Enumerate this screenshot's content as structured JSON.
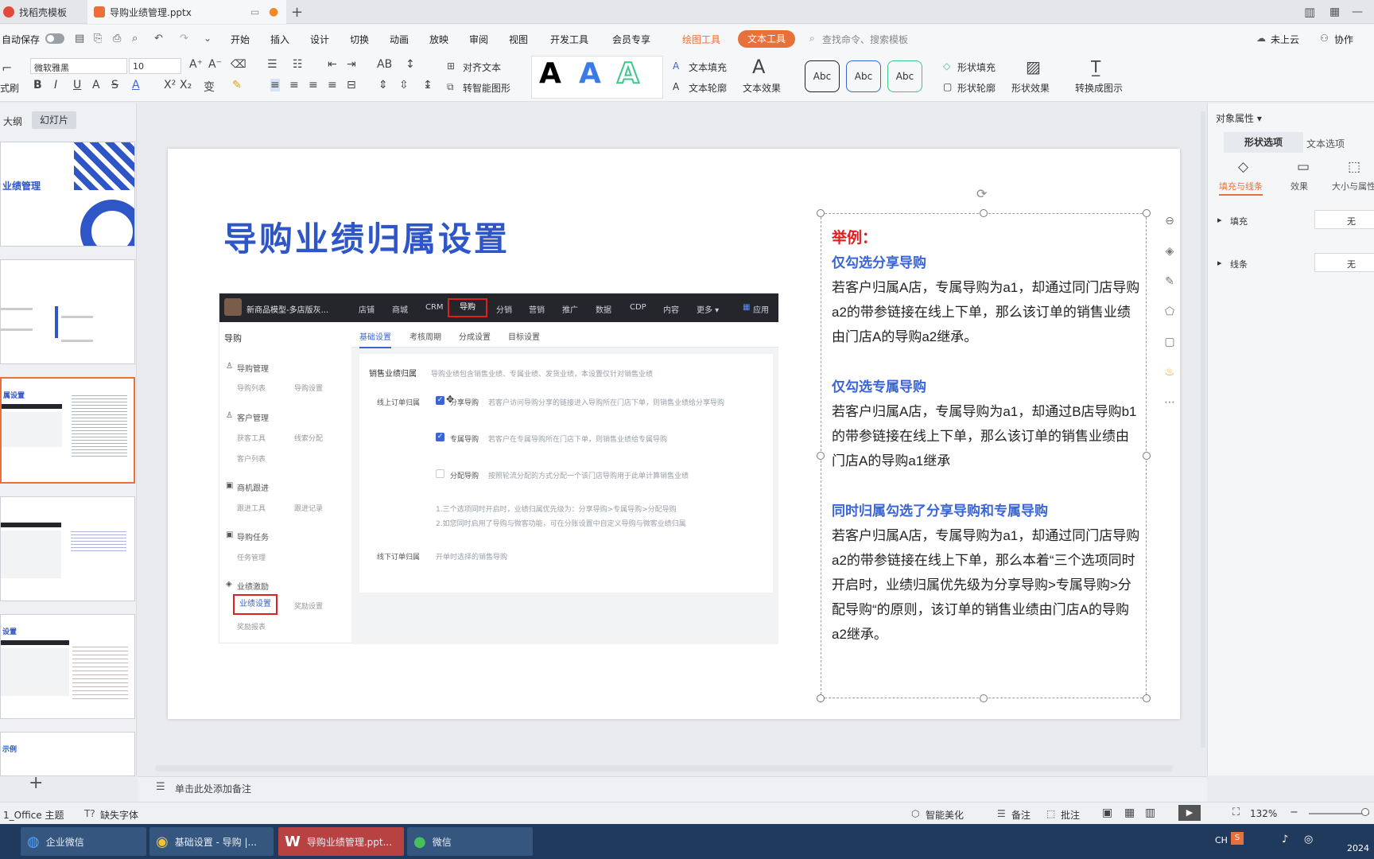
{
  "tabs": [
    {
      "label": "找稻壳模板"
    },
    {
      "label": "导购业绩管理.pptx"
    }
  ],
  "menu": {
    "autosave": "自动保存",
    "items": [
      "开始",
      "插入",
      "设计",
      "切换",
      "动画",
      "放映",
      "审阅",
      "视图",
      "开发工具",
      "会员专享"
    ],
    "drawing_tools": "绘图工具",
    "text_tools": "文本工具",
    "search_placeholder": "查找命令、搜索模板",
    "cloud": "未上云",
    "collab": "协作"
  },
  "ribbon": {
    "font": "微软雅黑",
    "size": "10",
    "align_text": "对齐文本",
    "smart_shape": "转智能图形",
    "text_fill": "文本填充",
    "text_outline": "文本轮廓",
    "text_effect": "文本效果",
    "abc": "Abc",
    "shape_fill": "形状填充",
    "shape_outline": "形状轮廓",
    "shape_effect": "形状效果",
    "convert": "转换成图示",
    "format": "式刷",
    "brand_colors": {
      "accent": "#e8703a",
      "blue": "#3b65d6",
      "red": "#e02020"
    }
  },
  "left": {
    "outline": "大纲",
    "slides": "幻灯片",
    "thumb1_title": "业绩管理",
    "thumb3_title": "属设置",
    "thumb5_title": "设置",
    "thumb6_title": "示例"
  },
  "slide": {
    "title": "导购业绩归属设置",
    "example_label": "举例：",
    "sections": [
      {
        "heading": "仅勾选分享导购",
        "body": "若客户归属A店，专属导购为a1，却通过同门店导购a2的带参链接在线上下单，那么该订单的销售业绩由门店A的导购a2继承。"
      },
      {
        "heading": "仅勾选专属导购",
        "body": "若客户归属A店，专属导购为a1，却通过B店导购b1的带参链接在线上下单，那么该订单的销售业绩由门店A的导购a1继承"
      },
      {
        "heading": "同时归属勾选了分享导购和专属导购",
        "body": "若客户归属A店，专属导购为a1，却通过同门店导购a2的带参链接在线上下单，那么本着“三个选项同时开启时，业绩归属优先级为分享导购>专属导购>分配导购“的原则，该订单的销售业绩由门店A的导购a2继承。"
      }
    ],
    "shot": {
      "store": "新商品模型-多店版灰...",
      "nav": [
        "店铺",
        "商城",
        "CRM",
        "导购",
        "分销",
        "营销",
        "推广",
        "数据",
        "CDP",
        "内容",
        "更多 ▾"
      ],
      "app": "应用",
      "side_title": "导购",
      "groups": [
        {
          "label": "导购管理",
          "subs": [
            "导购列表",
            "导购设置"
          ]
        },
        {
          "label": "客户管理",
          "subs": [
            "获客工具",
            "线索分配",
            "客户列表"
          ]
        },
        {
          "label": "商机跟进",
          "subs": [
            "跟进工具",
            "跟进记录"
          ]
        },
        {
          "label": "导购任务",
          "subs": [
            "任务管理"
          ]
        },
        {
          "label": "业绩激励",
          "subs": [
            "业绩设置",
            "奖励设置",
            "奖励报表"
          ]
        }
      ],
      "tabs": [
        "基础设置",
        "考核周期",
        "分成设置",
        "目标设置"
      ],
      "section_label": "销售业绩归属",
      "section_desc": "导购业绩包含销售业绩、专属业绩、发货业绩，本设置仅针对销售业绩",
      "online_label": "线上订单归属",
      "options": [
        {
          "name": "分享导购",
          "desc": "若客户访问导购分享的链接进入导购所在门店下单，则销售业绩给分享导购"
        },
        {
          "name": "专属导购",
          "desc": "若客户在专属导购所在门店下单，则销售业绩给专属导购"
        },
        {
          "name": "分配导购",
          "desc": "按照轮流分配的方式分配一个该门店导购用于此单计算销售业绩"
        }
      ],
      "note1": "1.三个选项同时开启时，业绩归属优先级为：分享导购>专属导购>分配导购",
      "note2": "2.如您同时启用了导购与微客功能，可在分账设置中自定义导购与微客业绩归属",
      "offline_label": "线下订单归属",
      "offline_desc": "开单时选择的销售导购"
    }
  },
  "right": {
    "title": "对象属性 ▾",
    "tab1": "形状选项",
    "tab2": "文本选项",
    "sub1": "填充与线条",
    "sub2": "效果",
    "sub3": "大小与属性",
    "fill": "填充",
    "fill_val": "无",
    "line": "线条",
    "line_val": "无"
  },
  "status": {
    "theme": "1_Office 主题",
    "font_missing": "缺失字体",
    "notes_hint": "单击此处添加备注",
    "beautify": "智能美化",
    "notes": "备注",
    "comment": "批注",
    "zoom": "132%"
  },
  "taskbar": {
    "apps": [
      "企业微信",
      "基础设置 - 导购 |...",
      "导购业绩管理.ppt...",
      "微信"
    ],
    "ime": "CH",
    "year": "2024"
  }
}
